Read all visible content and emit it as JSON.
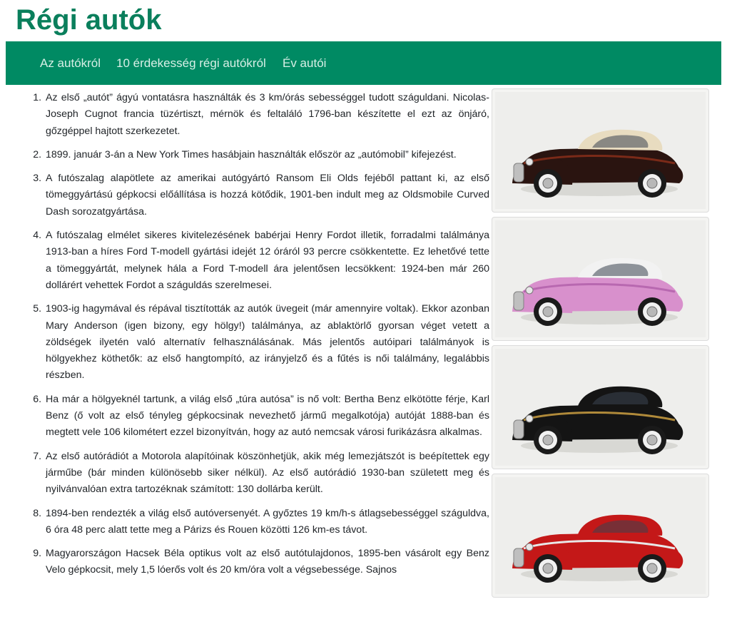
{
  "header": {
    "title": "Régi autók"
  },
  "nav": {
    "items": [
      {
        "label": "Az autókról"
      },
      {
        "label": "10 érdekesség régi autókról"
      },
      {
        "label": "Év autói"
      }
    ]
  },
  "facts": [
    "Az első „autót” ágyú vontatásra használták és 3 km/órás sebességgel tudott száguldani. Nicolas-Joseph Cugnot francia tüzértiszt, mérnök és feltaláló 1796-ban készítette el ezt az önjáró, gőzgéppel hajtott szerkezetet.",
    "1899. január 3-án a New York Times hasábjain használták először az „autómobil” kifejezést.",
    "A futószalag alapötlete az amerikai autógyártó Ransom Eli Olds fejéből pattant ki, az első tömeggyártású gépkocsi előállítása is hozzá kötődik, 1901-ben indult meg az Oldsmobile Curved Dash sorozatgyártása.",
    "A futószalag elmélet sikeres kivitelezésének babérjai Henry Fordot illetik, forradalmi találmánya 1913-ban a híres Ford T-modell gyártási idejét 12 óráról 93 percre csökkentette. Ez lehetővé tette a tömeggyártát, melynek hála a Ford T-modell ára jelentősen lecsökkent: 1924-ben már 260 dollárért vehettek Fordot a száguldás szerelmesei.",
    "1903-ig hagymával és répával tisztították az autók üvegeit (már amennyire voltak). Ekkor azonban Mary Anderson (igen bizony, egy hölgy!) találmánya, az ablaktörlő gyorsan véget vetett a zöldségek ilyetén való alternatív felhasználásának. Más jelentős autóipari találmányok is hölgyekhez köthetők: az első hangtompító, az irányjelző és a fűtés is női találmány, legalábbis részben.",
    "Ha már a hölgyeknél tartunk, a világ első „túra autósa” is nő volt: Bertha Benz elkötötte férje, Karl Benz (ő volt az első tényleg gépkocsinak nevezhető jármű megalkotója) autóját 1888-ban és megtett vele 106 kilométert ezzel bizonyítván, hogy az autó nemcsak városi furikázásra alkalmas.",
    "Az első autórádiót a Motorola alapítóinak köszönhetjük, akik még lemezjátszót is beépítettek egy járműbe (bár minden különösebb siker nélkül). Az első autórádió 1930-ban született meg és nyilvánvalóan extra tartozéknak számított: 130 dollárba került.",
    "1894-ben rendezték a világ első autóversenyét. A győztes 19 km/h-s átlagsebességgel száguldva, 6 óra 48 perc alatt tette meg a Párizs és Rouen közötti 126 km-es távot.",
    "Magyarországon Hacsek Béla optikus volt az első autótulajdonos, 1895-ben vásárolt egy Benz Velo gépkocsit, mely 1,5 lóerős volt és 20 km/óra volt a végsebessége. Sajnos"
  ],
  "gallery": {
    "images": [
      {
        "icon": "vintage-car-dark-brown-icon",
        "body": "#2a1410",
        "accent": "#7a2a18",
        "roof": "#e8dcc0"
      },
      {
        "icon": "vintage-car-pink-icon",
        "body": "#d890cc",
        "accent": "#b868b0",
        "roof": "#f2f2f2"
      },
      {
        "icon": "vintage-car-black-icon",
        "body": "#141414",
        "accent": "#b08a3a",
        "roof": "#141414"
      },
      {
        "icon": "vintage-car-red-icon",
        "body": "#c41818",
        "accent": "#e8e8e8",
        "roof": "#c41818"
      }
    ]
  }
}
